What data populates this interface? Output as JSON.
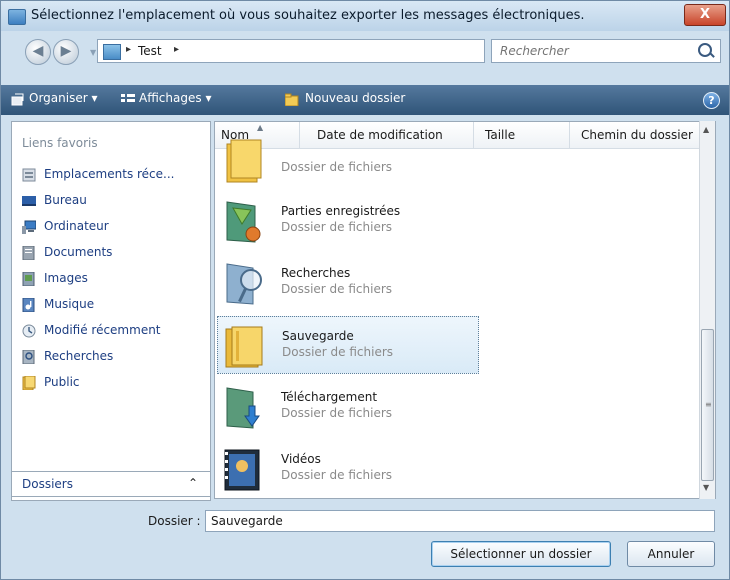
{
  "window": {
    "title": "Sélectionnez l'emplacement où vous souhaitez exporter les messages électroniques.",
    "close_label": "X"
  },
  "address_bar": {
    "crumbs": [
      "Test"
    ],
    "search_placeholder": "Rechercher"
  },
  "toolbar": {
    "organize": "Organiser",
    "views": "Affichages",
    "new_folder": "Nouveau dossier",
    "help": "?"
  },
  "sidebar": {
    "header": "Liens favoris",
    "items": [
      {
        "label": "Emplacements réce...",
        "icon": "recent-places-icon"
      },
      {
        "label": "Bureau",
        "icon": "desktop-icon"
      },
      {
        "label": "Ordinateur",
        "icon": "computer-icon"
      },
      {
        "label": "Documents",
        "icon": "documents-icon"
      },
      {
        "label": "Images",
        "icon": "pictures-icon"
      },
      {
        "label": "Musique",
        "icon": "music-icon"
      },
      {
        "label": "Modifié récemment",
        "icon": "recently-changed-icon"
      },
      {
        "label": "Recherches",
        "icon": "searches-icon"
      },
      {
        "label": "Public",
        "icon": "public-folder-icon"
      }
    ],
    "folders_label": "Dossiers"
  },
  "columns": {
    "name": "Nom",
    "date": "Date de modification",
    "size": "Taille",
    "path": "Chemin du dossier"
  },
  "files": [
    {
      "name": "",
      "type": "Dossier de fichiers",
      "icon": "folder-icon"
    },
    {
      "name": "Parties enregistrées",
      "type": "Dossier de fichiers",
      "icon": "saved-games-folder-icon"
    },
    {
      "name": "Recherches",
      "type": "Dossier de fichiers",
      "icon": "searches-folder-icon"
    },
    {
      "name": "Sauvegarde",
      "type": "Dossier de fichiers",
      "icon": "folder-icon",
      "selected": true
    },
    {
      "name": "Téléchargement",
      "type": "Dossier de fichiers",
      "icon": "downloads-folder-icon"
    },
    {
      "name": "Vidéos",
      "type": "Dossier de fichiers",
      "icon": "videos-folder-icon"
    }
  ],
  "footer": {
    "folder_label": "Dossier :",
    "folder_value": "Sauvegarde",
    "select_button": "Sélectionner un dossier",
    "cancel_button": "Annuler"
  },
  "colors": {
    "toolbar": "#3f6489",
    "link": "#1d3e82",
    "selection": "#d9eaf7"
  }
}
